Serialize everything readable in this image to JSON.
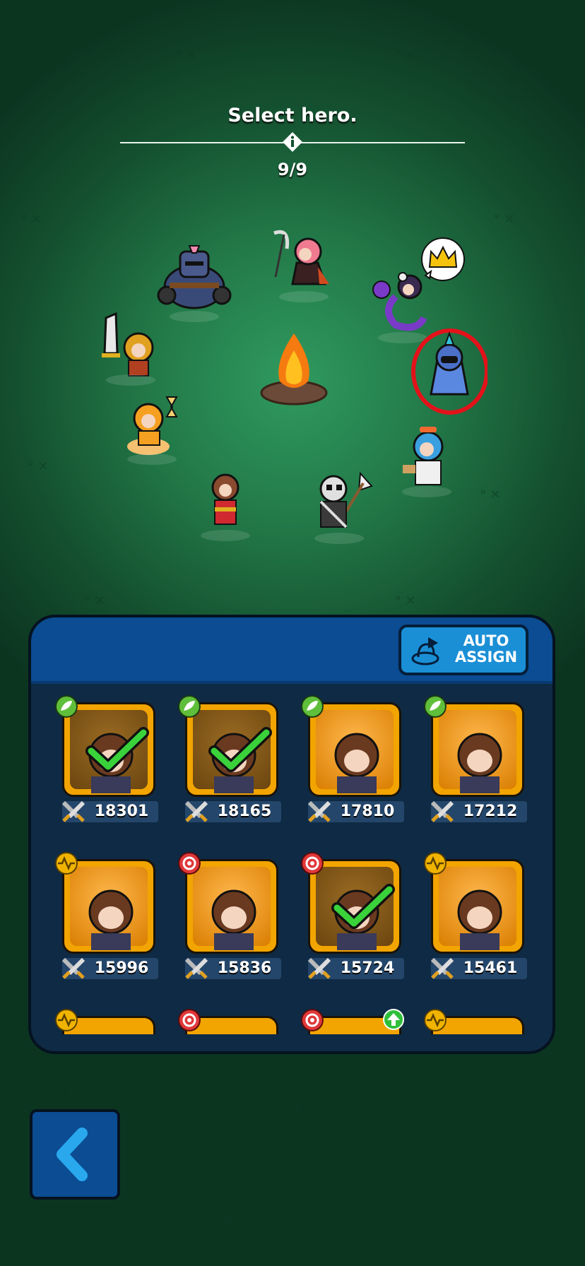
{
  "header": {
    "title": "Select hero.",
    "counter": "9/9"
  },
  "icons": {
    "info": "info-diamond-icon",
    "crown": "crown-icon",
    "back": "chevron-left-icon",
    "auto_assign": "helmet-arrow-icon",
    "power": "crossed-swords-icon",
    "upgrade": "green-arrow-up-icon"
  },
  "auto_assign": {
    "line1": "AUTO",
    "line2": "ASSIGN"
  },
  "elements": {
    "nature": "#5fbf3a",
    "light": "#f0b400",
    "fire": "#e0383a"
  },
  "hero_cards": [
    {
      "element": "nature",
      "power": "18301",
      "selected": true
    },
    {
      "element": "nature",
      "power": "18165",
      "selected": true
    },
    {
      "element": "nature",
      "power": "17810",
      "selected": false
    },
    {
      "element": "nature",
      "power": "17212",
      "selected": false
    },
    {
      "element": "light",
      "power": "15996",
      "selected": false
    },
    {
      "element": "fire",
      "power": "15836",
      "selected": false
    },
    {
      "element": "fire",
      "power": "15724",
      "selected": true
    },
    {
      "element": "light",
      "power": "15461",
      "selected": false
    }
  ],
  "partial_cards": [
    {
      "element": "light",
      "upgrade": false
    },
    {
      "element": "fire",
      "upgrade": false
    },
    {
      "element": "fire",
      "upgrade": true
    },
    {
      "element": "light",
      "upgrade": false
    }
  ]
}
